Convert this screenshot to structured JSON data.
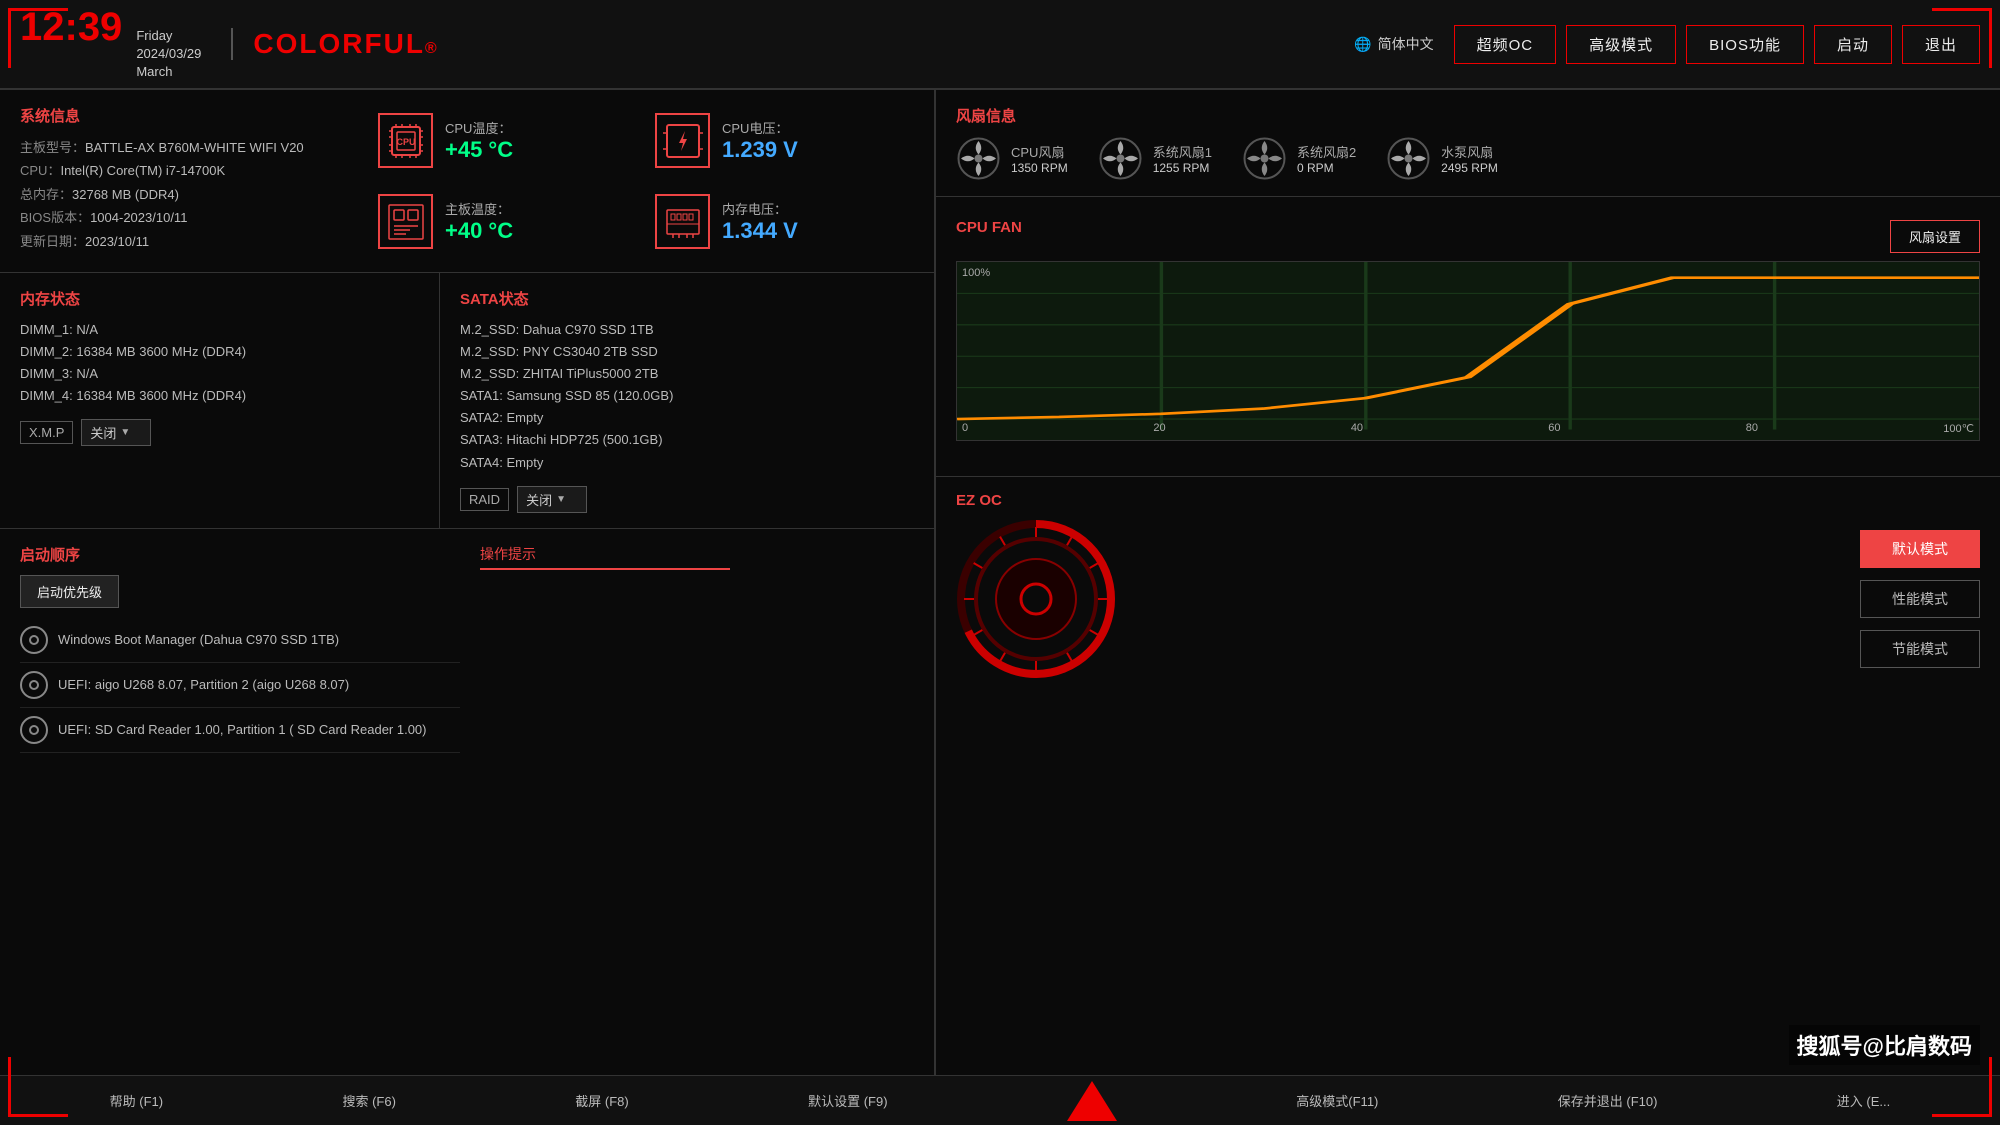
{
  "header": {
    "time": "12:39",
    "day": "Friday",
    "date": "2024/03/29",
    "month": "March",
    "logo": "COLORFUL",
    "logo_mark": "®",
    "lang_icon": "🌐",
    "lang": "简体中文",
    "nav": [
      "超频OC",
      "高级模式",
      "BIOS功能",
      "启动",
      "退出"
    ]
  },
  "system_info": {
    "title": "系统信息",
    "motherboard_label": "主板型号：",
    "motherboard": "BATTLE-AX B760M-WHITE WIFI V20",
    "cpu_label": "CPU：",
    "cpu": "Intel(R) Core(TM) i7-14700K",
    "ram_label": "总内存：",
    "ram": "32768 MB (DDR4)",
    "bios_label": "BIOS版本：",
    "bios": "1004-2023/10/11",
    "update_label": "更新日期：",
    "update": "2023/10/11",
    "cpu_temp_label": "CPU温度：",
    "cpu_temp": "+45 °C",
    "board_temp_label": "主板温度：",
    "board_temp": "+40 °C",
    "cpu_volt_label": "CPU电压：",
    "cpu_volt": "1.239 V",
    "mem_volt_label": "内存电压：",
    "mem_volt": "1.344 V"
  },
  "memory": {
    "title": "内存状态",
    "dimm1": "DIMM_1: N/A",
    "dimm2": "DIMM_2: 16384 MB  3600 MHz (DDR4)",
    "dimm3": "DIMM_3: N/A",
    "dimm4": "DIMM_4: 16384 MB  3600 MHz (DDR4)",
    "xmp_label": "X.M.P",
    "xmp_value": "关闭"
  },
  "sata": {
    "title": "SATA状态",
    "m2_1": "M.2_SSD: Dahua C970 SSD 1TB",
    "m2_2": "M.2_SSD: PNY CS3040 2TB SSD",
    "m2_3": "M.2_SSD: ZHITAI TiPlus5000 2TB",
    "sata1": "SATA1: Samsung SSD 85 (120.0GB)",
    "sata2": "SATA2: Empty",
    "sata3": "SATA3: Hitachi HDP725 (500.1GB)",
    "sata4": "SATA4: Empty",
    "raid_label": "RAID",
    "raid_value": "关闭"
  },
  "boot": {
    "title": "启动顺序",
    "priority_btn": "启动优先级",
    "item1": "Windows Boot Manager (Dahua C970 SSD 1TB)",
    "item2": "UEFI: aigo U268 8.07, Partition 2 (aigo U268 8.07)",
    "item3": "UEFI:  SD Card Reader 1.00, Partition 1 ( SD Card Reader 1.00)",
    "ops_hint": "操作提示"
  },
  "fan_info": {
    "title": "风扇信息",
    "cpu_fan_label": "CPU风扇",
    "cpu_fan_rpm": "1350 RPM",
    "sys_fan1_label": "系统风扇1",
    "sys_fan1_rpm": "1255 RPM",
    "sys_fan2_label": "系统风扇2",
    "sys_fan2_rpm": "0 RPM",
    "pump_fan_label": "水泵风扇",
    "pump_fan_rpm": "2495 RPM"
  },
  "cpu_fan_chart": {
    "title": "CPU FAN",
    "y_max": "100%",
    "y_min": "0",
    "x_labels": [
      "20",
      "40",
      "60",
      "80",
      "100℃"
    ],
    "settings_btn": "风扇设置"
  },
  "ez_oc": {
    "title": "EZ OC",
    "default_btn": "默认模式",
    "performance_btn": "性能模式",
    "eco_btn": "节能模式"
  },
  "footer": {
    "help": "帮助 (F1)",
    "search": "搜索 (F6)",
    "screenshot": "截屏 (F8)",
    "default": "默认设置 (F9)",
    "advanced": "高级模式(F11)",
    "save_exit": "保存并退出 (F10)",
    "enter": "进入 (E..."
  },
  "watermark": "搜狐号@比肩数码"
}
